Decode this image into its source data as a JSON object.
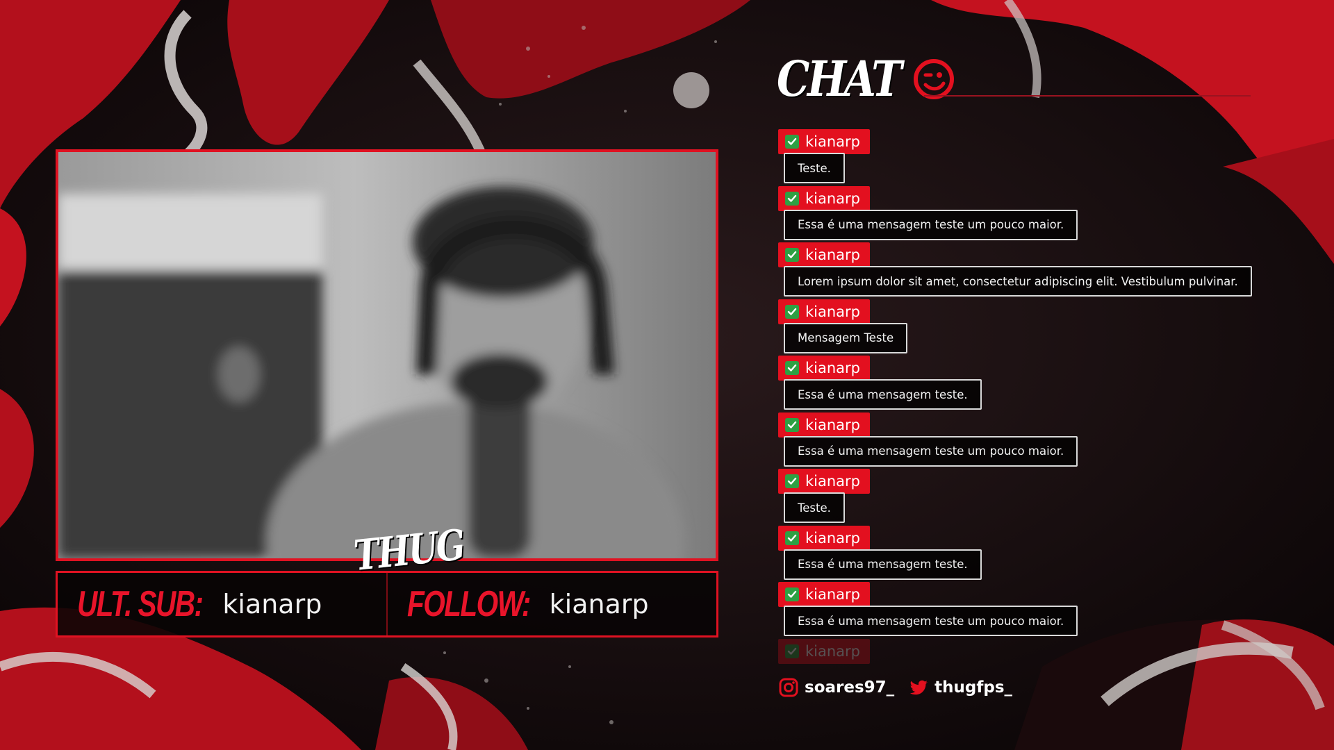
{
  "colors": {
    "accent": "#e3101f",
    "background": "#0b0607",
    "text": "#ffffff"
  },
  "overlay": {
    "logo_text": "THUG",
    "last_sub": {
      "label": "ULT. SUB:",
      "value": "kianarp"
    },
    "last_follow": {
      "label": "FOLLOW:",
      "value": "kianarp"
    }
  },
  "chat": {
    "title": "CHAT",
    "title_icon": "wink-face-icon",
    "messages": [
      {
        "user": "kianarp",
        "badge": "check-badge-icon",
        "text": "Teste."
      },
      {
        "user": "kianarp",
        "badge": "check-badge-icon",
        "text": "Essa é uma mensagem teste um pouco maior."
      },
      {
        "user": "kianarp",
        "badge": "check-badge-icon",
        "text": "Lorem ipsum dolor sit amet, consectetur adipiscing elit. Vestibulum pulvinar."
      },
      {
        "user": "kianarp",
        "badge": "check-badge-icon",
        "text": "Mensagem Teste"
      },
      {
        "user": "kianarp",
        "badge": "check-badge-icon",
        "text": "Essa é uma mensagem teste."
      },
      {
        "user": "kianarp",
        "badge": "check-badge-icon",
        "text": "Essa é uma mensagem teste um pouco maior."
      },
      {
        "user": "kianarp",
        "badge": "check-badge-icon",
        "text": "Teste."
      },
      {
        "user": "kianarp",
        "badge": "check-badge-icon",
        "text": "Essa é uma mensagem teste."
      },
      {
        "user": "kianarp",
        "badge": "check-badge-icon",
        "text": "Essa é uma mensagem teste um pouco maior."
      }
    ],
    "faded_message": {
      "user": "kianarp",
      "badge": "check-badge-icon"
    }
  },
  "socials": [
    {
      "icon": "instagram-icon",
      "handle": "soares97_"
    },
    {
      "icon": "twitter-icon",
      "handle": "thugfps_"
    }
  ]
}
